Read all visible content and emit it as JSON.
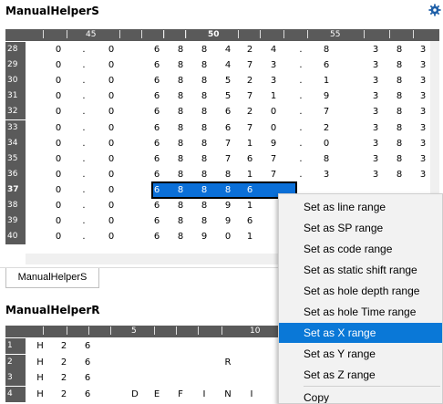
{
  "panel_s": {
    "title": "ManualHelperS",
    "tab_label": "ManualHelperS",
    "ruler_labels": [
      "45",
      "50",
      "55"
    ],
    "rows": [
      {
        "num": "28",
        "cells": [
          "0",
          ".",
          "0",
          "6",
          "8",
          "8",
          "4",
          "2",
          "4",
          ".",
          "8",
          "",
          "3",
          "8",
          "3"
        ]
      },
      {
        "num": "29",
        "cells": [
          "0",
          ".",
          "0",
          "6",
          "8",
          "8",
          "4",
          "7",
          "3",
          ".",
          "6",
          "",
          "3",
          "8",
          "3"
        ]
      },
      {
        "num": "30",
        "cells": [
          "0",
          ".",
          "0",
          "6",
          "8",
          "8",
          "5",
          "2",
          "3",
          ".",
          "1",
          "",
          "3",
          "8",
          "3"
        ]
      },
      {
        "num": "31",
        "cells": [
          "0",
          ".",
          "0",
          "6",
          "8",
          "8",
          "5",
          "7",
          "1",
          ".",
          "9",
          "",
          "3",
          "8",
          "3"
        ]
      },
      {
        "num": "32",
        "cells": [
          "0",
          ".",
          "0",
          "6",
          "8",
          "8",
          "6",
          "2",
          "0",
          ".",
          "7",
          "",
          "3",
          "8",
          "3"
        ]
      },
      {
        "num": "33",
        "cells": [
          "0",
          ".",
          "0",
          "6",
          "8",
          "8",
          "6",
          "7",
          "0",
          ".",
          "2",
          "",
          "3",
          "8",
          "3"
        ]
      },
      {
        "num": "34",
        "cells": [
          "0",
          ".",
          "0",
          "6",
          "8",
          "8",
          "7",
          "1",
          "9",
          ".",
          "0",
          "",
          "3",
          "8",
          "3"
        ]
      },
      {
        "num": "35",
        "cells": [
          "0",
          ".",
          "0",
          "6",
          "8",
          "8",
          "7",
          "6",
          "7",
          ".",
          "8",
          "",
          "3",
          "8",
          "3"
        ]
      },
      {
        "num": "36",
        "cells": [
          "0",
          ".",
          "0",
          "6",
          "8",
          "8",
          "8",
          "1",
          "7",
          ".",
          "3",
          "",
          "3",
          "8",
          "3"
        ]
      },
      {
        "num": "37",
        "cells": [
          "0",
          ".",
          "0",
          "6",
          "8",
          "8",
          "8",
          "6",
          "",
          "",
          "",
          "",
          "",
          "",
          ""
        ]
      },
      {
        "num": "38",
        "cells": [
          "0",
          ".",
          "0",
          "6",
          "8",
          "8",
          "9",
          "1",
          "",
          "",
          "",
          "",
          "",
          "",
          ""
        ]
      },
      {
        "num": "39",
        "cells": [
          "0",
          ".",
          "0",
          "6",
          "8",
          "8",
          "9",
          "6",
          "",
          "",
          "",
          "",
          "",
          "",
          ""
        ]
      },
      {
        "num": "40",
        "cells": [
          "0",
          ".",
          "0",
          "6",
          "8",
          "9",
          "0",
          "1",
          "",
          "",
          "",
          "",
          "",
          "",
          ""
        ]
      }
    ]
  },
  "panel_r": {
    "title": "ManualHelperR",
    "ruler_labels": [
      "5",
      "10"
    ],
    "rows": [
      {
        "num": "1",
        "cells": [
          "H",
          "2",
          "6",
          "",
          "",
          "",
          "",
          "",
          "",
          "",
          ""
        ]
      },
      {
        "num": "2",
        "cells": [
          "H",
          "2",
          "6",
          "",
          "",
          "",
          "",
          "",
          "R",
          "",
          ""
        ]
      },
      {
        "num": "3",
        "cells": [
          "H",
          "2",
          "6",
          "",
          "",
          "",
          "",
          "",
          "",
          "",
          ""
        ]
      },
      {
        "num": "4",
        "cells": [
          "H",
          "2",
          "6",
          "",
          "D",
          "E",
          "F",
          "I",
          "N",
          "I",
          ""
        ]
      }
    ]
  },
  "context_menu": {
    "items": [
      "Set as line range",
      "Set as SP range",
      "Set as code range",
      "Set as static shift range",
      "Set as hole depth range",
      "Set as hole Time range",
      "Set as X range",
      "Set as Y range",
      "Set as Z range",
      "Copy"
    ],
    "highlighted_index": 6
  },
  "colors": {
    "selection": "#0a6fd8",
    "menu_highlight": "#0a78d7",
    "header_bg": "#5a5a5a",
    "gear": "#1e5fa8"
  },
  "icons": {
    "settings": "gear-icon"
  }
}
